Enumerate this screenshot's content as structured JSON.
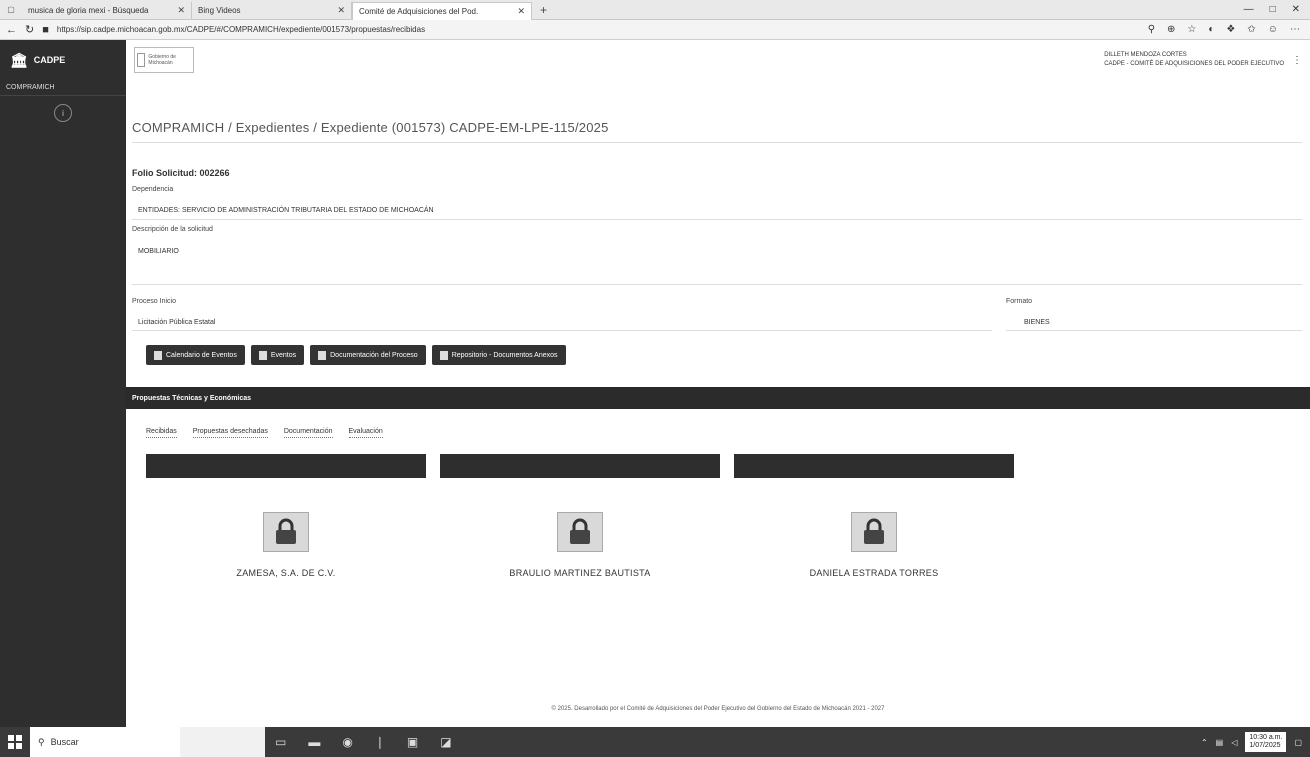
{
  "browser": {
    "tabs": [
      {
        "label": "musica de gloria mexi - Búsqueda",
        "active": false
      },
      {
        "label": "Bing Videos",
        "active": false
      },
      {
        "label": "Comité de Adquisiciones del Pod.",
        "active": true
      }
    ],
    "url": "https://sip.cadpe.michoacan.gob.mx/CADPE/#/COMPRAMICH/expediente/001573/propuestas/recibidas"
  },
  "sidebar": {
    "brand": "CADPE",
    "items": [
      {
        "label": "COMPRAMICH"
      }
    ]
  },
  "header": {
    "gov_logo_text": "Gobierno de Michoacán",
    "user_name": "DILLETH MENDOZA CORTES",
    "user_role": "CADPE - COMITÉ DE ADQUISICIONES DEL PODER EJECUTIVO"
  },
  "page": {
    "breadcrumb": "COMPRAMICH / Expedientes / Expediente (001573) CADPE-EM-LPE-115/2025",
    "folio": "Folio Solicitud: 002266",
    "dependencia_label": "Dependencia",
    "dependencia_value": "ENTIDADES: SERVICIO DE ADMINISTRACIÓN TRIBUTARIA DEL ESTADO DE MICHOACÁN",
    "descripcion_label": "Descripción de la solicitud",
    "descripcion_value": "MOBILIARIO",
    "proceso_label": "Proceso Inicio",
    "proceso_value": "Licitación Pública Estatal",
    "formato_label": "Formato",
    "formato_value": "BIENES"
  },
  "buttons": [
    {
      "label": "Calendario de Eventos"
    },
    {
      "label": "Eventos"
    },
    {
      "label": "Documentación del Proceso"
    },
    {
      "label": "Repositorio - Documentos Anexos"
    }
  ],
  "section": {
    "title": "Propuestas Técnicas y Económicas",
    "subtabs": [
      "Recibidas",
      "Propuestas desechadas",
      "Documentación",
      "Evaluación"
    ]
  },
  "proposals": [
    {
      "name": "ZAMESA, S.A. DE C.V."
    },
    {
      "name": "BRAULIO MARTINEZ BAUTISTA"
    },
    {
      "name": "DANIELA ESTRADA TORRES"
    }
  ],
  "footer": "© 2025. Desarrollado por el Comité de Adquisiciones del Poder Ejecutivo del Gobierno del Estado de Michoacán 2021 - 2027",
  "taskbar": {
    "search_label": "Buscar",
    "time": "10:30 a.m.",
    "date": "1/07/2025"
  }
}
